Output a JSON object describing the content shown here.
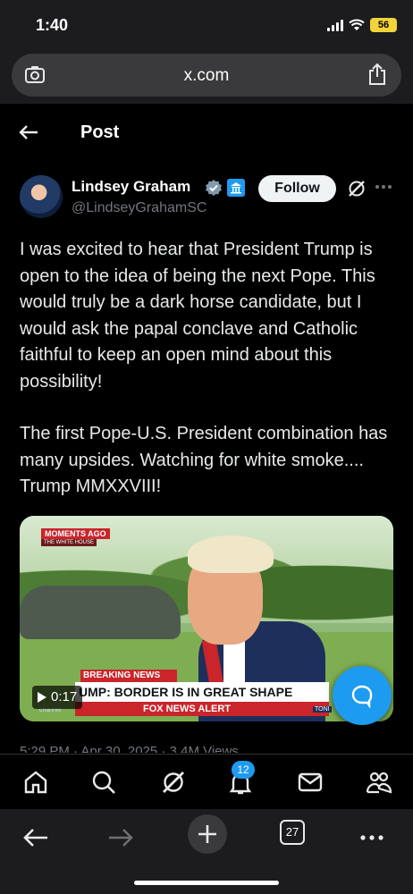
{
  "status_bar": {
    "time": "1:40",
    "battery": "56"
  },
  "browser": {
    "url": "x.com",
    "tab_count": "27"
  },
  "header": {
    "title": "Post"
  },
  "author": {
    "name": "Lindsey Graham",
    "handle": "@LindseyGrahamSC",
    "follow_label": "Follow"
  },
  "post": {
    "paragraphs": [
      "I was excited to hear that President Trump is open to the idea of being the next Pope. This would truly be a dark horse candidate, but I would ask the papal conclave and Catholic faithful to keep an open mind about this possibility!",
      "The first Pope-U.S. President combination has many upsides. Watching for white smoke.... Trump MMXXVIII!"
    ],
    "meta_peek": "5:29 PM · Apr 30, 2025 · 3.4M Views"
  },
  "media": {
    "duration": "0:17",
    "moments_ago": "MOMENTS AGO",
    "location": "THE WHITE HOUSE",
    "breaking": "BREAKING NEWS",
    "headline": "UMP: BORDER IS IN GREAT SHAPE",
    "alert": "FOX NEWS ALERT",
    "channel": "channel",
    "tag": "TONI"
  },
  "bottom_nav": {
    "notifications_count": "12"
  },
  "colors": {
    "accent": "#1d9bf0",
    "background": "#000000",
    "secondary_text": "#71767b"
  }
}
